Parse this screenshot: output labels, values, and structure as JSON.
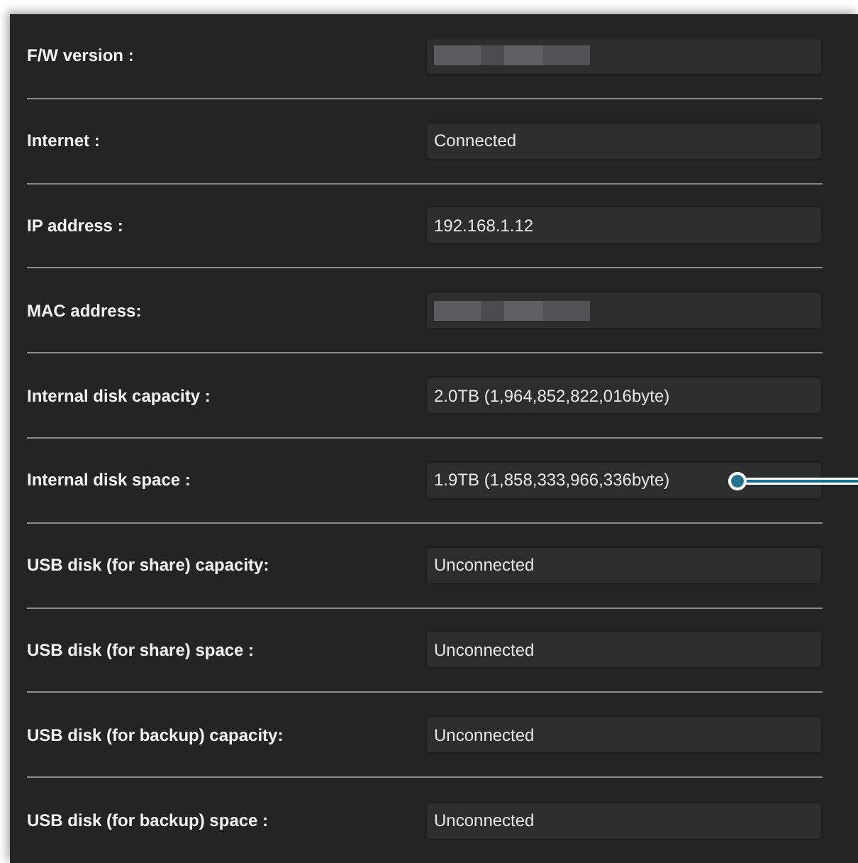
{
  "rows": [
    {
      "label": "F/W version :",
      "redacted": true
    },
    {
      "label": "Internet :",
      "value": "Connected"
    },
    {
      "label": "IP address :",
      "value": "192.168.1.12"
    },
    {
      "label": "MAC address:",
      "redacted": true
    },
    {
      "label": "Internal disk capacity :",
      "value": "2.0TB (1,964,852,822,016byte)"
    },
    {
      "label": "Internal disk space :",
      "value": "1.9TB (1,858,333,966,336byte)",
      "callout": true
    },
    {
      "label": "USB disk (for share) capacity:",
      "value": "Unconnected"
    },
    {
      "label": "USB disk (for share) space :",
      "value": "Unconnected"
    },
    {
      "label": "USB disk (for backup) capacity:",
      "value": "Unconnected"
    },
    {
      "label": "USB disk (for backup) space :",
      "value": "Unconnected"
    }
  ]
}
